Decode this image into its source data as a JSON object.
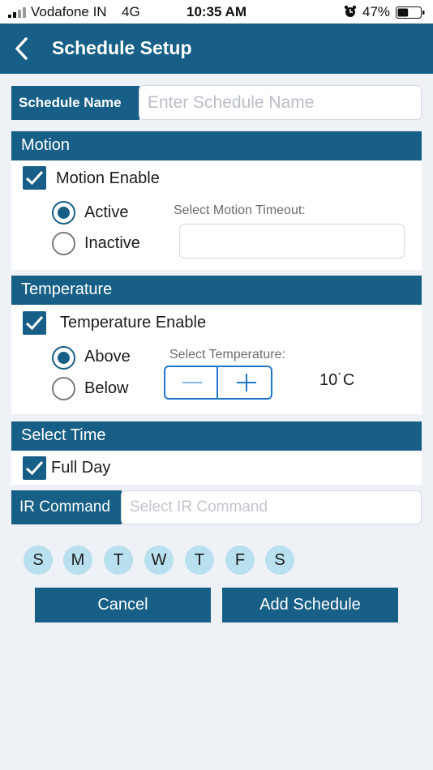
{
  "status_bar": {
    "carrier": "Vodafone IN",
    "network": "4G",
    "time": "10:35 AM",
    "battery": "47%",
    "battery_level": 0.47
  },
  "nav": {
    "title": "Schedule Setup",
    "back_icon": "chevron-left-icon"
  },
  "schedule_name": {
    "label": "Schedule Name",
    "placeholder": "Enter Schedule Name",
    "value": ""
  },
  "motion": {
    "header": "Motion",
    "enable_label": "Motion Enable",
    "enabled": true,
    "options": [
      "Active",
      "Inactive"
    ],
    "selected": "Active",
    "timeout_label": "Select Motion Timeout:",
    "timeout_value": ""
  },
  "temperature": {
    "header": "Temperature",
    "enable_label": "Temperature Enable",
    "enabled": true,
    "options": [
      "Above",
      "Below"
    ],
    "selected": "Above",
    "select_label": "Select Temperature:",
    "value": "10˙C"
  },
  "time": {
    "header": "Select Time",
    "full_day_label": "Full Day",
    "full_day": true
  },
  "ir_command": {
    "label": "IR Command",
    "placeholder": "Select IR Command",
    "value": ""
  },
  "days": [
    "S",
    "M",
    "T",
    "W",
    "T",
    "F",
    "S"
  ],
  "buttons": {
    "cancel": "Cancel",
    "add": "Add Schedule"
  },
  "colors": {
    "primary": "#175f86",
    "day_bubble": "#b8e0ef",
    "stepper_border": "#1f77c8",
    "background": "#eef1f5"
  }
}
